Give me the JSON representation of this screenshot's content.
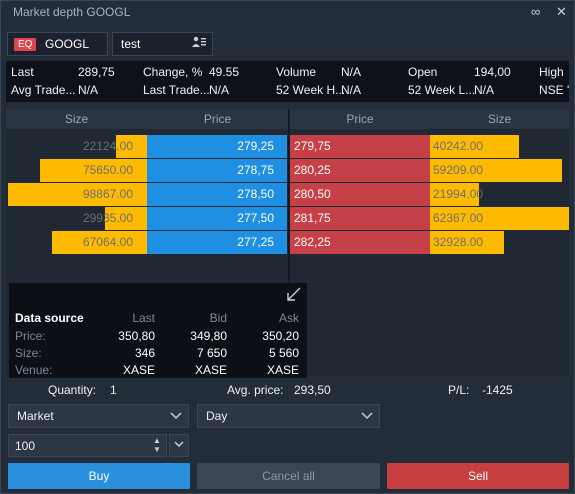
{
  "title": "Market depth GOOGL",
  "symbol": {
    "badge": "EQ",
    "ticker": "GOOGL"
  },
  "account": {
    "name": "test"
  },
  "quote": {
    "last_label": "Last",
    "last_value": "289,75",
    "change_label": "Change, %",
    "change_value": "49.55",
    "volume_label": "Volume",
    "volume_value": "N/A",
    "open_label": "Open",
    "open_value": "194,00",
    "high_label": "High",
    "avg_trade_label": "Avg Trade...",
    "avg_trade_value": "N/A",
    "last_trade_label": "Last Trade...",
    "last_trade_value": "N/A",
    "week_high_label": "52 Week H...",
    "week_high_value": "N/A",
    "week_low_label": "52 Week L...",
    "week_low_value": "N/A",
    "exchange_value": "NSE '"
  },
  "depth": {
    "headers": {
      "bid_size": "Size",
      "bid_price": "Price",
      "ask_price": "Price",
      "ask_size": "Size"
    },
    "bids": [
      {
        "size": "22124.00",
        "price": "279,25",
        "fill": 0.22
      },
      {
        "size": "75650.00",
        "price": "278,75",
        "fill": 0.77
      },
      {
        "size": "98867.00",
        "price": "278,50",
        "fill": 1.0
      },
      {
        "size": "29935.00",
        "price": "277,50",
        "fill": 0.3
      },
      {
        "size": "67064.00",
        "price": "277,25",
        "fill": 0.68
      }
    ],
    "asks": [
      {
        "price": "279,75",
        "size": "40242.00",
        "fill": 0.64
      },
      {
        "price": "280,25",
        "size": "59209.00",
        "fill": 0.95
      },
      {
        "price": "280,50",
        "size": "21994.00",
        "fill": 0.35
      },
      {
        "price": "281,75",
        "size": "62367.00",
        "fill": 1.0
      },
      {
        "price": "282,25",
        "size": "32928.00",
        "fill": 0.53
      }
    ]
  },
  "data_source": {
    "title": "Data source",
    "col_last": "Last",
    "col_bid": "Bid",
    "col_ask": "Ask",
    "rows": [
      {
        "label": "Price:",
        "last": "350,80",
        "bid": "349,80",
        "ask": "350,20"
      },
      {
        "label": "Size:",
        "last": "346",
        "bid": "7 650",
        "ask": "5 560"
      },
      {
        "label": "Venue:",
        "last": "XASE",
        "bid": "XASE",
        "ask": "XASE"
      }
    ]
  },
  "footer": {
    "quantity_label": "Quantity:",
    "quantity_value": "1",
    "avg_price_label": "Avg. price:",
    "avg_price_value": "293,50",
    "pl_label": "P/L:",
    "pl_value": "-1425"
  },
  "order": {
    "type_value": "Market",
    "tif_value": "Day",
    "quantity_value": "100"
  },
  "buttons": {
    "buy": "Buy",
    "cancel_all": "Cancel all",
    "sell": "Sell"
  },
  "colors": {
    "bid_price": "#1e8fe1",
    "ask_price": "#c64047",
    "size_bar": "#ffbb00",
    "buy": "#2a8fdc",
    "sell": "#c63e3e",
    "cancel": "#3a4656"
  }
}
